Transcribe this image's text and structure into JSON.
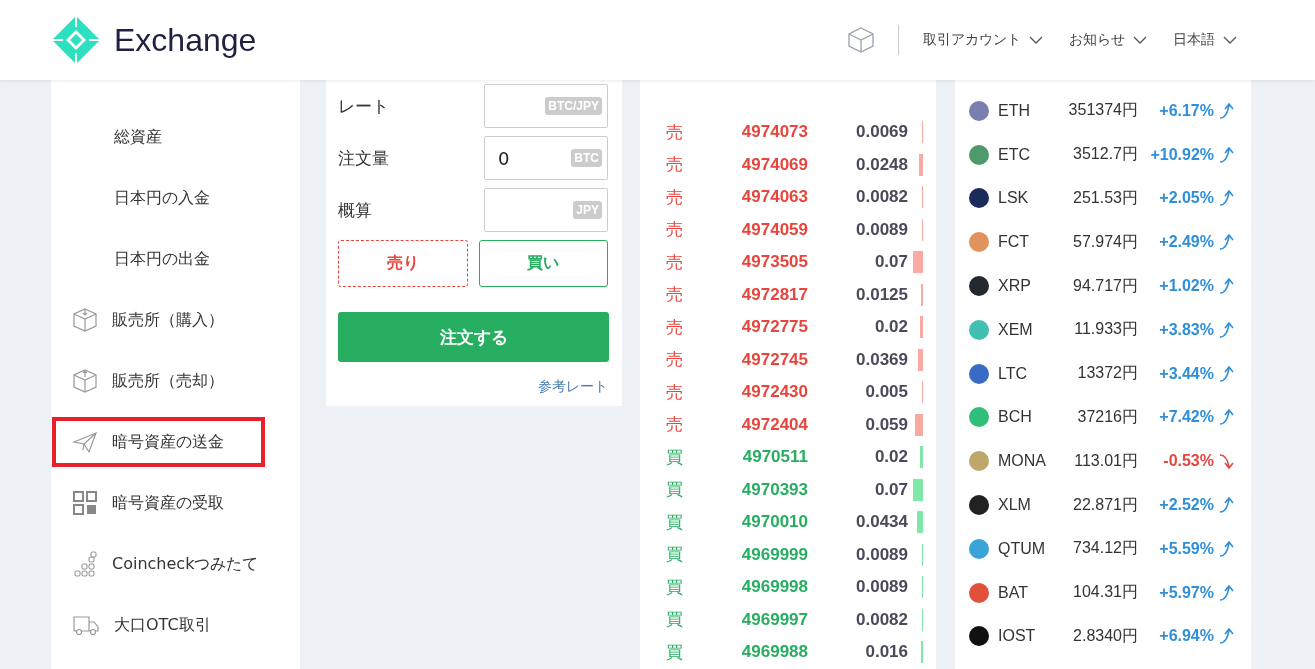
{
  "header": {
    "brand": "Exchange",
    "menus": [
      {
        "label": "取引アカウント"
      },
      {
        "label": "お知らせ"
      },
      {
        "label": "日本語"
      }
    ]
  },
  "sidebar": {
    "items": [
      {
        "label": "総資産",
        "kind": "sub",
        "highlighted": false
      },
      {
        "label": "日本円の入金",
        "kind": "sub",
        "highlighted": false
      },
      {
        "label": "日本円の出金",
        "kind": "sub",
        "highlighted": false
      },
      {
        "label": "販売所（購入）",
        "kind": "buy",
        "highlighted": false
      },
      {
        "label": "販売所（売却）",
        "kind": "sell",
        "highlighted": false
      },
      {
        "label": "暗号資産の送金",
        "kind": "send",
        "highlighted": true
      },
      {
        "label": "暗号資産の受取",
        "kind": "receive",
        "highlighted": false
      },
      {
        "label": "Coincheckつみたて",
        "kind": "savings",
        "highlighted": false
      },
      {
        "label": "大口OTC取引",
        "kind": "otc",
        "highlighted": false
      }
    ]
  },
  "order_form": {
    "fields": [
      {
        "label": "レート",
        "unit": "BTC/JPY"
      },
      {
        "label": "注文量",
        "value": "0",
        "unit": "BTC"
      },
      {
        "label": "概算",
        "unit": "JPY"
      }
    ],
    "sides": [
      {
        "label": "売り",
        "kind": "sell",
        "selected": true
      },
      {
        "label": "買い",
        "kind": "buy",
        "selected": false
      }
    ],
    "submit": "注文する",
    "reference_link": "参考レート"
  },
  "order_book": {
    "rows": [
      {
        "side": "売",
        "kind": "sell",
        "price": "4974073",
        "amount": "0.0069"
      },
      {
        "side": "売",
        "kind": "sell",
        "price": "4974069",
        "amount": "0.0248"
      },
      {
        "side": "売",
        "kind": "sell",
        "price": "4974063",
        "amount": "0.0082"
      },
      {
        "side": "売",
        "kind": "sell",
        "price": "4974059",
        "amount": "0.0089"
      },
      {
        "side": "売",
        "kind": "sell",
        "price": "4973505",
        "amount": "0.07"
      },
      {
        "side": "売",
        "kind": "sell",
        "price": "4972817",
        "amount": "0.0125"
      },
      {
        "side": "売",
        "kind": "sell",
        "price": "4972775",
        "amount": "0.02"
      },
      {
        "side": "売",
        "kind": "sell",
        "price": "4972745",
        "amount": "0.0369"
      },
      {
        "side": "売",
        "kind": "sell",
        "price": "4972430",
        "amount": "0.005"
      },
      {
        "side": "売",
        "kind": "sell",
        "price": "4972404",
        "amount": "0.059"
      },
      {
        "side": "買",
        "kind": "buy",
        "price": "4970511",
        "amount": "0.02"
      },
      {
        "side": "買",
        "kind": "buy",
        "price": "4970393",
        "amount": "0.07"
      },
      {
        "side": "買",
        "kind": "buy",
        "price": "4970010",
        "amount": "0.0434"
      },
      {
        "side": "買",
        "kind": "buy",
        "price": "4969999",
        "amount": "0.0089"
      },
      {
        "side": "買",
        "kind": "buy",
        "price": "4969998",
        "amount": "0.0089"
      },
      {
        "side": "買",
        "kind": "buy",
        "price": "4969997",
        "amount": "0.0082"
      },
      {
        "side": "買",
        "kind": "buy",
        "price": "4969988",
        "amount": "0.016"
      }
    ]
  },
  "coins": [
    {
      "symbol": "ETH",
      "price": "351374円",
      "change": "+6.17%",
      "rising": true,
      "color": "#7b7fb0"
    },
    {
      "symbol": "ETC",
      "price": "3512.7円",
      "change": "+10.92%",
      "rising": true,
      "color": "#4f9a6a"
    },
    {
      "symbol": "LSK",
      "price": "251.53円",
      "change": "+2.05%",
      "rising": true,
      "color": "#1a2a5a"
    },
    {
      "symbol": "FCT",
      "price": "57.974円",
      "change": "+2.49%",
      "rising": true,
      "color": "#e0935a"
    },
    {
      "symbol": "XRP",
      "price": "94.717円",
      "change": "+1.02%",
      "rising": true,
      "color": "#23292f"
    },
    {
      "symbol": "XEM",
      "price": "11.933円",
      "change": "+3.83%",
      "rising": true,
      "color": "#41bfb0"
    },
    {
      "symbol": "LTC",
      "price": "13372円",
      "change": "+3.44%",
      "rising": true,
      "color": "#3a6bc4"
    },
    {
      "symbol": "BCH",
      "price": "37216円",
      "change": "+7.42%",
      "rising": true,
      "color": "#2fbf7a"
    },
    {
      "symbol": "MONA",
      "price": "113.01円",
      "change": "-0.53%",
      "rising": false,
      "color": "#bfa66a"
    },
    {
      "symbol": "XLM",
      "price": "22.871円",
      "change": "+2.52%",
      "rising": true,
      "color": "#222222"
    },
    {
      "symbol": "QTUM",
      "price": "734.12円",
      "change": "+5.59%",
      "rising": true,
      "color": "#3aa4d8"
    },
    {
      "symbol": "BAT",
      "price": "104.31円",
      "change": "+5.97%",
      "rising": true,
      "color": "#e0503a"
    },
    {
      "symbol": "IOST",
      "price": "2.8340円",
      "change": "+6.94%",
      "rising": true,
      "color": "#111111"
    }
  ]
}
